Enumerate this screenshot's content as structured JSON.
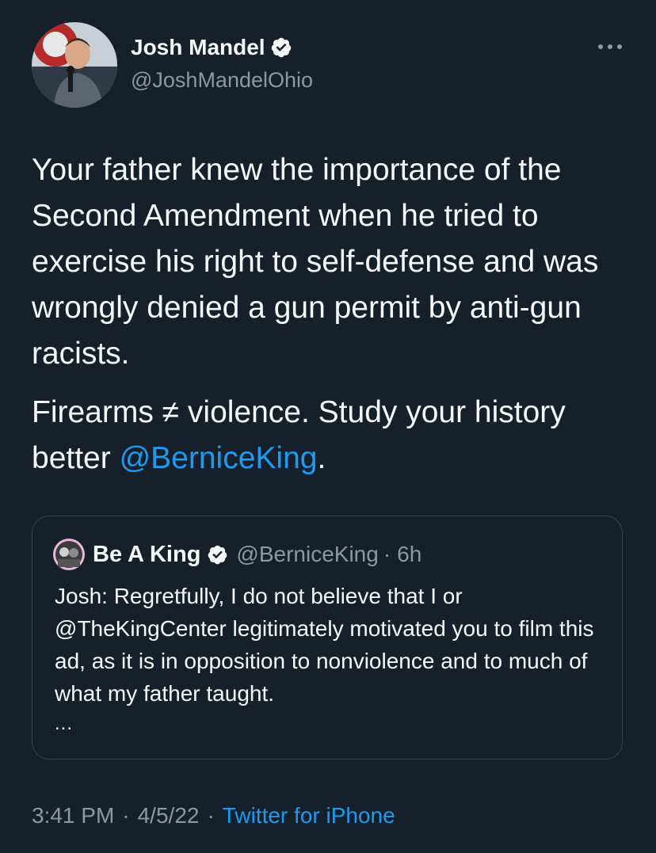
{
  "author": {
    "name": "Josh Mandel",
    "handle": "@JoshMandelOhio",
    "avatar_icon": "avatar-photo",
    "verified_icon": "verified-badge-icon",
    "verified_color": "#f7f9f9"
  },
  "tweet": {
    "paragraph1": "Your father knew the importance of the Second Amendment when he tried to exercise his right to self-defense and was wrongly denied a gun permit by anti-gun racists.",
    "paragraph2_text": "Firearms ≠ violence. Study your history better ",
    "paragraph2_mention": "@BerniceKing",
    "paragraph2_end": "."
  },
  "quote": {
    "name": "Be A King",
    "handle": "@BerniceKing",
    "dot": "·",
    "time": "6h",
    "text": "Josh: Regretfully, I do not believe that I or @TheKingCenter legitimately motivated you to film this ad, as it is in opposition to nonviolence and to much of what my father taught.",
    "ellipsis": "..."
  },
  "meta": {
    "time": "3:41 PM",
    "sep1": "·",
    "date": "4/5/22",
    "sep2": "·",
    "source": "Twitter for iPhone"
  },
  "colors": {
    "background": "#15202b",
    "text": "#f7f9f9",
    "secondary": "#8b98a5",
    "link": "#1d9bf0",
    "border": "#38444d"
  }
}
